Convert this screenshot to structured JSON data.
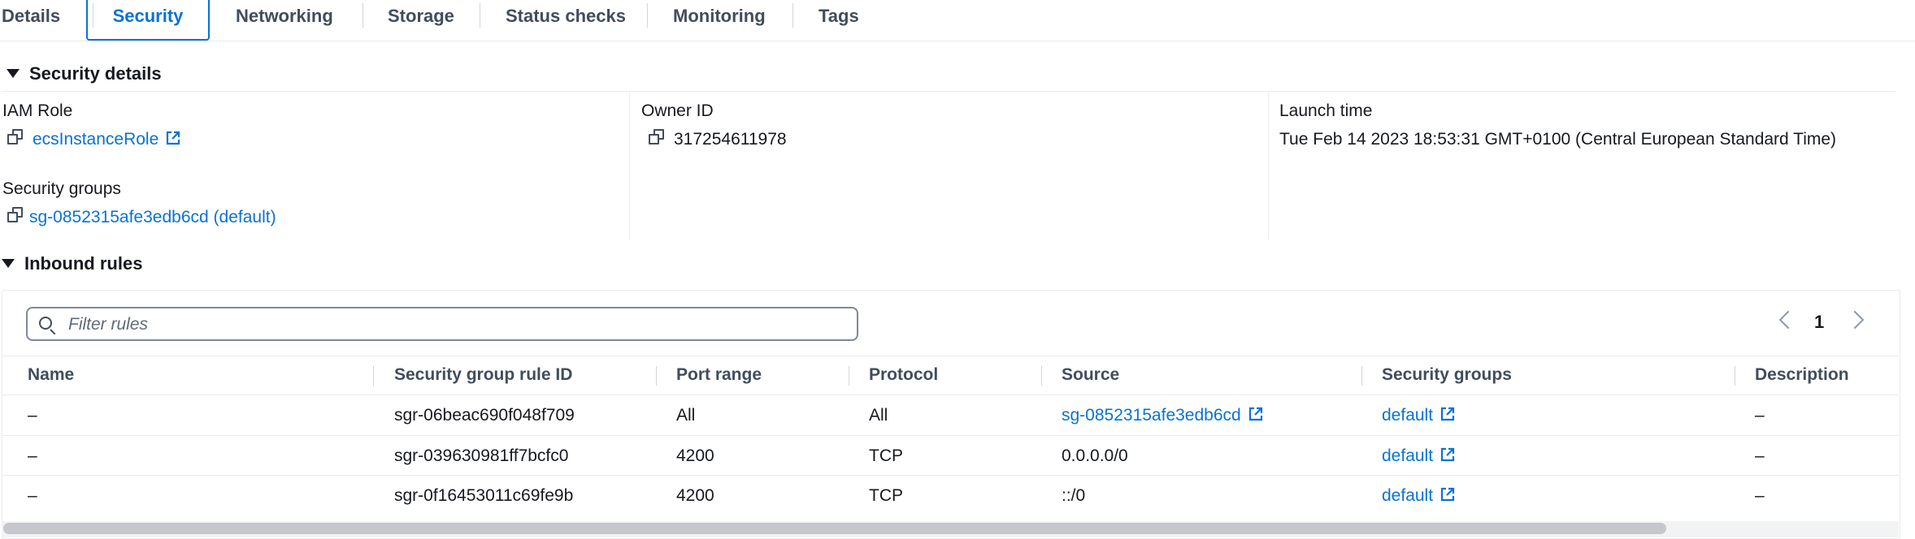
{
  "tabs": [
    {
      "label": "Details"
    },
    {
      "label": "Security"
    },
    {
      "label": "Networking"
    },
    {
      "label": "Storage"
    },
    {
      "label": "Status checks"
    },
    {
      "label": "Monitoring"
    },
    {
      "label": "Tags"
    }
  ],
  "active_tab": "Security",
  "security_details": {
    "title": "Security details",
    "iam_role": {
      "label": "IAM Role",
      "value": "ecsInstanceRole"
    },
    "owner_id": {
      "label": "Owner ID",
      "value": "317254611978"
    },
    "launch_time": {
      "label": "Launch time",
      "value": "Tue Feb 14 2023 18:53:31 GMT+0100 (Central European Standard Time)"
    },
    "security_groups": {
      "label": "Security groups",
      "value": "sg-0852315afe3edb6cd (default)"
    }
  },
  "inbound_rules": {
    "title": "Inbound rules",
    "filter_placeholder": "Filter rules",
    "page": "1",
    "columns": [
      "Name",
      "Security group rule ID",
      "Port range",
      "Protocol",
      "Source",
      "Security groups",
      "Description"
    ],
    "rows": [
      {
        "name": "–",
        "rule_id": "sgr-06beac690f048f709",
        "port_range": "All",
        "protocol": "All",
        "source": "sg-0852315afe3edb6cd",
        "security_group": "default",
        "description": "–"
      },
      {
        "name": "–",
        "rule_id": "sgr-039630981ff7bcfc0",
        "port_range": "4200",
        "protocol": "TCP",
        "source": "0.0.0.0/0",
        "security_group": "default",
        "description": "–"
      },
      {
        "name": "–",
        "rule_id": "sgr-0f16453011c69fe9b",
        "port_range": "4200",
        "protocol": "TCP",
        "source": "::/0",
        "security_group": "default",
        "description": "–"
      }
    ]
  },
  "colors": {
    "link": "#0972d3",
    "text": "#16191f",
    "header_text": "#414d5c"
  }
}
